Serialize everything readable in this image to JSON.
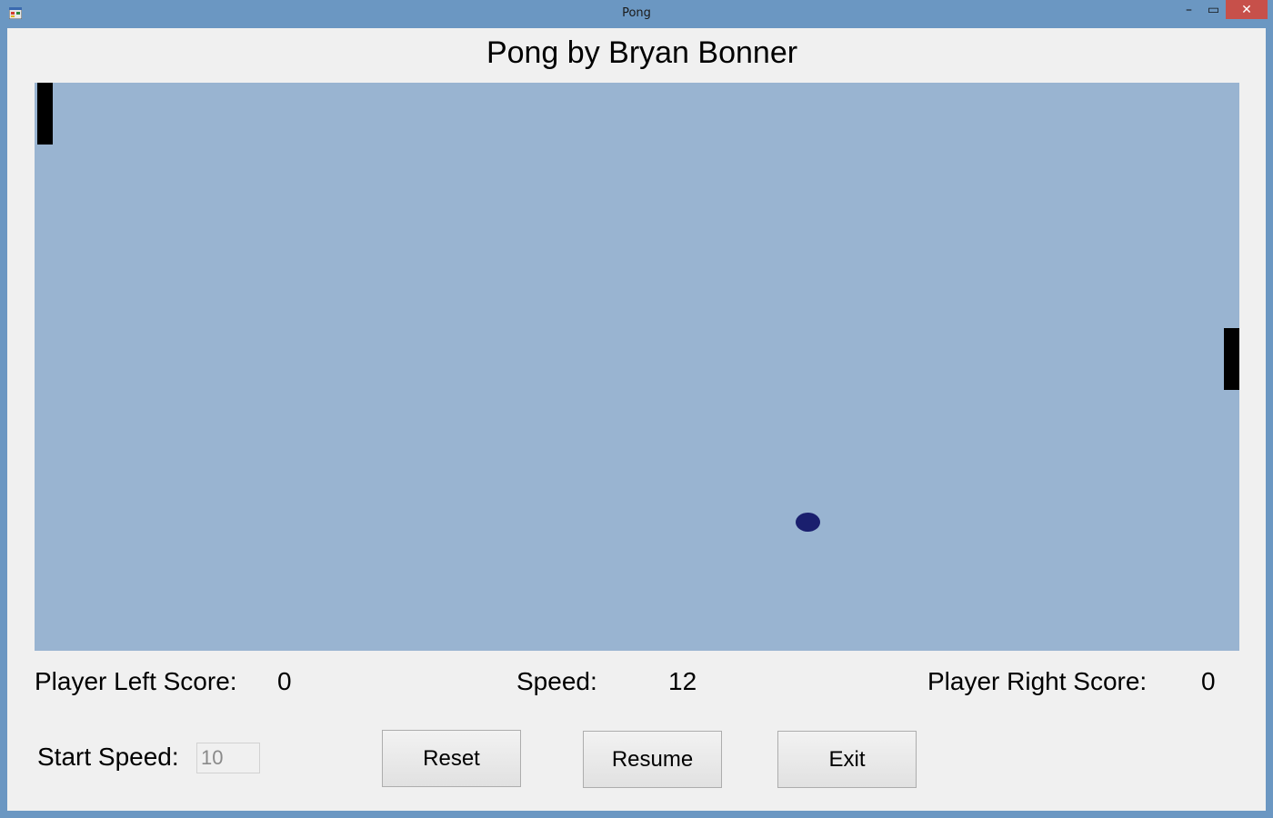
{
  "window": {
    "title": "Pong",
    "minimize_glyph": "–",
    "maximize_glyph": "▭",
    "close_glyph": "✕"
  },
  "header": {
    "title": "Pong by Bryan Bonner"
  },
  "game": {
    "court_color": "#99b4d1",
    "paddle_color": "#000000",
    "ball_color": "#1a1f6e"
  },
  "stats": {
    "left_score_label": "Player Left Score:",
    "left_score_value": "0",
    "speed_label": "Speed:",
    "speed_value": "12",
    "right_score_label": "Player Right Score:",
    "right_score_value": "0"
  },
  "controls": {
    "start_speed_label": "Start Speed:",
    "start_speed_value": "10",
    "reset_label": "Reset",
    "resume_label": "Resume",
    "exit_label": "Exit"
  }
}
